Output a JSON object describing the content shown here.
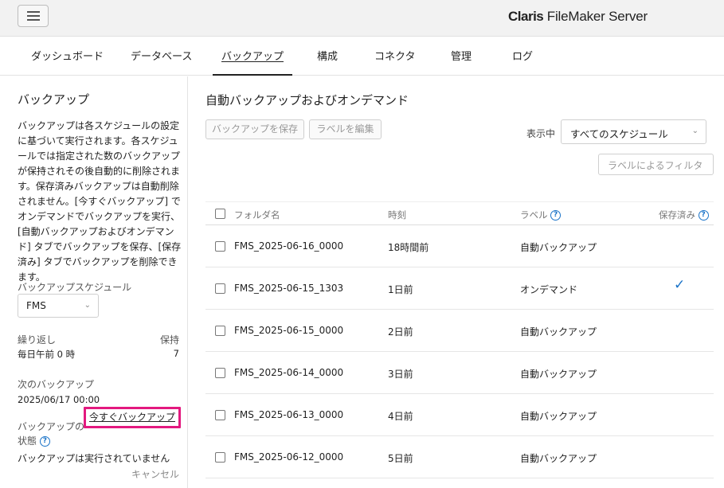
{
  "header": {
    "brand_bold": "Claris",
    "brand_rest": " FileMaker Server"
  },
  "nav": {
    "tabs": [
      {
        "label": "ダッシュボード"
      },
      {
        "label": "データベース"
      },
      {
        "label": "バックアップ"
      },
      {
        "label": "構成"
      },
      {
        "label": "コネクタ"
      },
      {
        "label": "管理"
      },
      {
        "label": "ログ"
      }
    ]
  },
  "sidebar": {
    "title": "バックアップ",
    "description": "バックアップは各スケジュールの設定に基づいて実行されます。各スケジュールでは指定された数のバックアップが保持されその後自動的に削除されます。保存済みバックアップは自動削除されません。[今すぐバックアップ] でオンデマンドでバックアップを実行、[自動バックアップおよびオンデマンド] タブでバックアップを保存、[保存済み] タブでバックアップを削除できます。",
    "schedule_label": "バックアップスケジュール",
    "schedule_value": "FMS",
    "repeat_label": "繰り返し",
    "repeat_value": "毎日午前 0 時",
    "keep_label": "保持",
    "keep_value": "7",
    "next_label": "次のバックアップ",
    "next_value": "2025/06/17 00:00",
    "backup_now_label": "今すぐバックアップ",
    "status_label_1": "バックアップの",
    "status_label_2": "状態",
    "status_value": "バックアップは実行されていません",
    "cancel_label": "キャンセル"
  },
  "main": {
    "title": "自動バックアップおよびオンデマンド",
    "save_button": "バックアップを保存",
    "edit_label_button": "ラベルを編集",
    "show_label": "表示中",
    "schedule_filter": "すべてのスケジュール",
    "label_filter_placeholder": "ラベルによるフィルタ"
  },
  "table": {
    "headers": {
      "folder": "フォルダ名",
      "time": "時刻",
      "label": "ラベル",
      "saved": "保存済み"
    },
    "rows": [
      {
        "folder": "FMS_2025-06-16_0000",
        "time": "18時間前",
        "label": "自動バックアップ",
        "saved": false
      },
      {
        "folder": "FMS_2025-06-15_1303",
        "time": "1日前",
        "label": "オンデマンド",
        "saved": true
      },
      {
        "folder": "FMS_2025-06-15_0000",
        "time": "2日前",
        "label": "自動バックアップ",
        "saved": false
      },
      {
        "folder": "FMS_2025-06-14_0000",
        "time": "3日前",
        "label": "自動バックアップ",
        "saved": false
      },
      {
        "folder": "FMS_2025-06-13_0000",
        "time": "4日前",
        "label": "自動バックアップ",
        "saved": false
      },
      {
        "folder": "FMS_2025-06-12_0000",
        "time": "5日前",
        "label": "自動バックアップ",
        "saved": false
      }
    ]
  },
  "colors": {
    "accent": "#1a73c8",
    "highlight": "#e3197f"
  },
  "icons": {
    "menu": "hamburger-icon",
    "help": "help-icon",
    "check": "checkmark-icon",
    "chevron": "chevron-down-icon"
  }
}
